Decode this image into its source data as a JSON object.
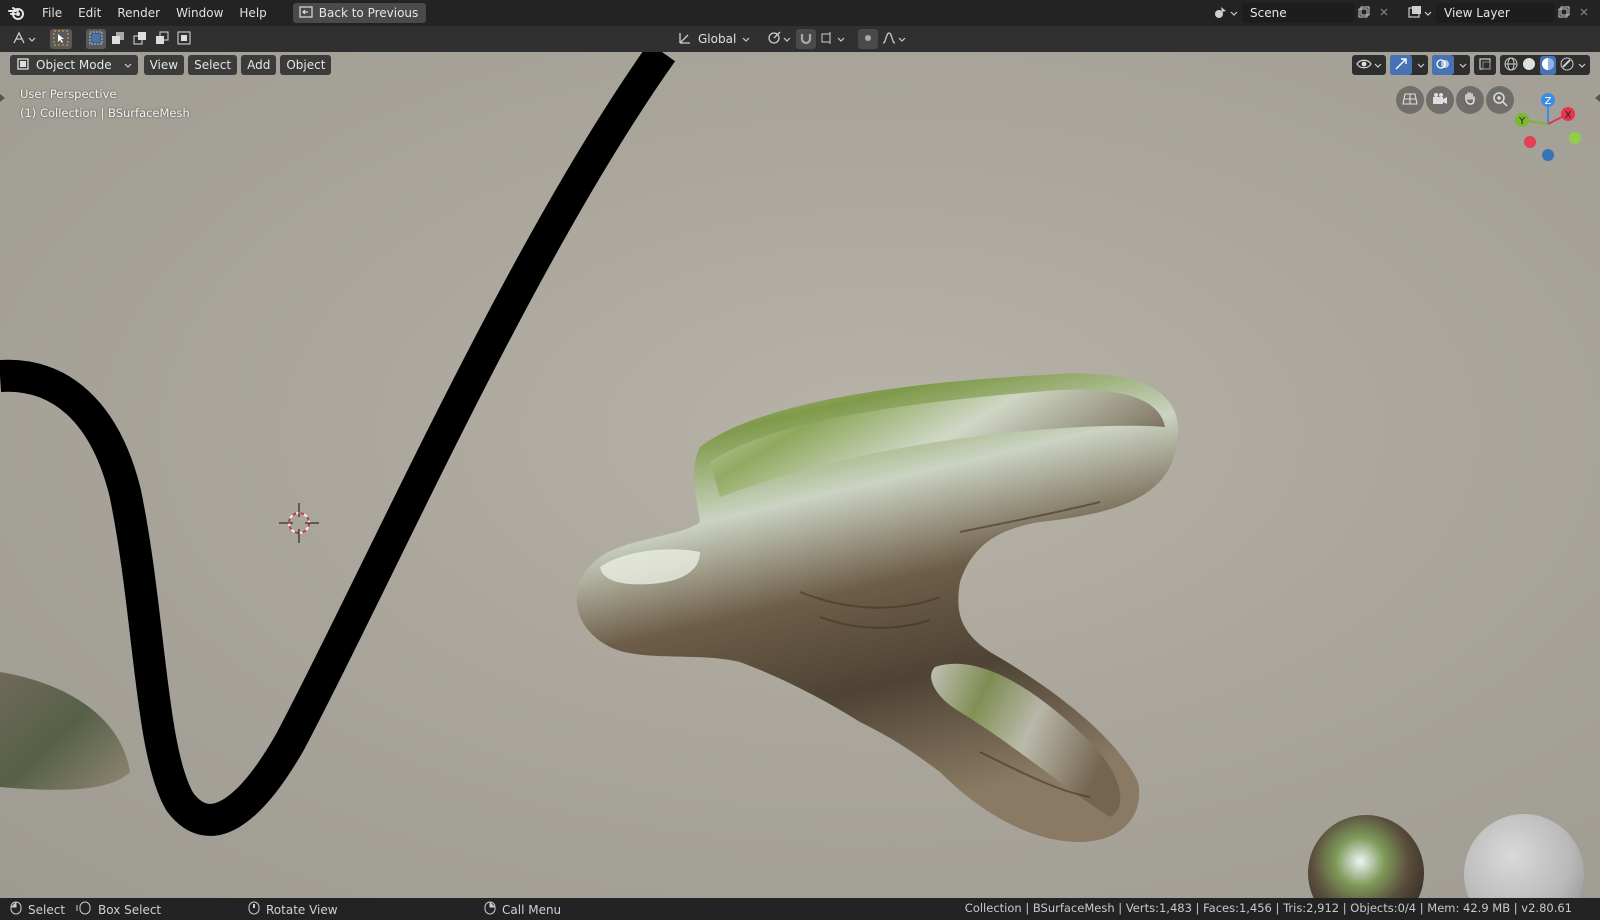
{
  "menubar": {
    "items": [
      "File",
      "Edit",
      "Render",
      "Window",
      "Help"
    ],
    "back_button": "Back to Previous"
  },
  "scene": {
    "name": "Scene"
  },
  "view_layer": {
    "name": "View Layer"
  },
  "toolbar": {
    "orientation": "Global"
  },
  "viewport_header": {
    "mode": "Object Mode",
    "menus": [
      "View",
      "Select",
      "Add",
      "Object"
    ]
  },
  "viewport": {
    "perspective": "User Perspective",
    "collection_info": "(1) Collection | BSurfaceMesh",
    "gizmo": {
      "x_label": "X",
      "y_label": "Y",
      "z_label": "Z"
    }
  },
  "statusbar": {
    "select": "Select",
    "box_select": "Box Select",
    "rotate_view": "Rotate View",
    "call_menu": "Call Menu",
    "stats": "Collection | BSurfaceMesh | Verts:1,483 | Faces:1,456 | Tris:2,912 | Objects:0/4 | Mem: 42.9 MB | v2.80.61"
  },
  "colors": {
    "accent_blue": "#4772b3",
    "axis_x": "#e8354f",
    "axis_y": "#7cb82f",
    "axis_z": "#3a8ee6",
    "select_tool": "#f0a030"
  }
}
